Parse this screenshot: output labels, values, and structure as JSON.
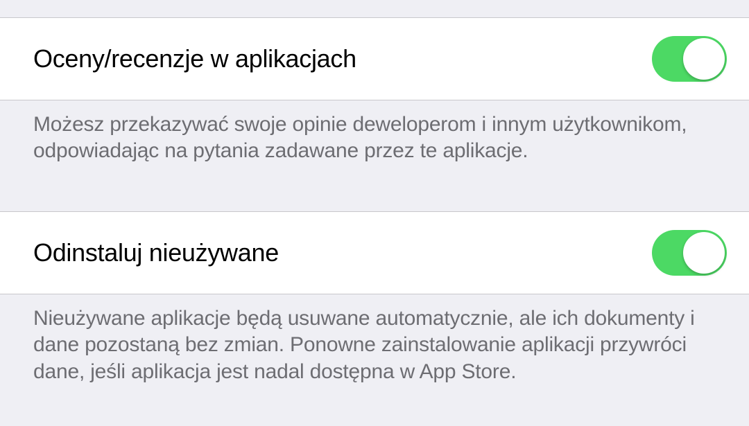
{
  "settings": [
    {
      "label": "Oceny/recenzje w aplikacjach",
      "enabled": true,
      "footer": "Możesz przekazywać swoje opinie deweloperom i innym użytkownikom, odpowiadając na pytania zadawane przez te aplikacje."
    },
    {
      "label": "Odinstaluj nieużywane",
      "enabled": true,
      "footer": "Nieużywane aplikacje będą usuwane automatycznie, ale ich dokumenty i dane pozostaną bez zmian. Ponowne zainstalowanie aplikacji przywróci dane, jeśli aplikacja jest nadal dostępna w App Store."
    }
  ],
  "colors": {
    "toggle_on": "#4cd964",
    "background": "#efeff4",
    "cell_background": "#ffffff",
    "footer_text": "#6d6d72"
  }
}
